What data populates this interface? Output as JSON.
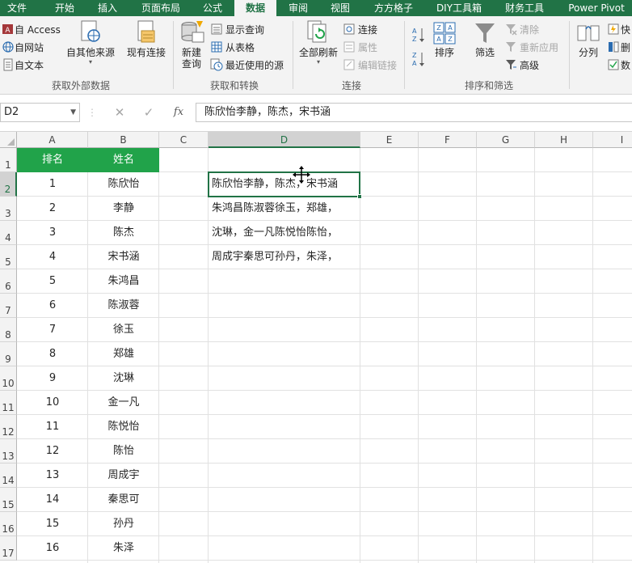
{
  "ribbon_tabs": [
    "文件",
    "开始",
    "插入",
    "页面布局",
    "公式",
    "数据",
    "审阅",
    "视图",
    "方方格子",
    "DIY工具箱",
    "财务工具",
    "Power Pivot"
  ],
  "active_tab": "数据",
  "get_external": {
    "access": "自 Access",
    "web": "自网站",
    "text": "自文本",
    "other_sources": "自其他来源",
    "existing": "现有连接",
    "group_label": "获取外部数据"
  },
  "get_transform": {
    "new_query_l1": "新建",
    "new_query_l2": "查询",
    "show_queries": "显示查询",
    "from_table": "从表格",
    "recent_sources": "最近使用的源",
    "group_label": "获取和转换"
  },
  "connections": {
    "refresh_all": "全部刷新",
    "connections": "连接",
    "properties": "属性",
    "edit_links": "编辑链接",
    "group_label": "连接"
  },
  "sort_filter": {
    "sort": "排序",
    "filter": "筛选",
    "clear": "清除",
    "reapply": "重新应用",
    "advanced": "高级",
    "group_label": "排序和筛选"
  },
  "data_tools": {
    "text_to_columns": "分列",
    "flash_fill": "快",
    "remove_dup": "删",
    "validation": "数"
  },
  "formula_bar": {
    "name_box": "D2",
    "cancel": "✕",
    "enter": "✓",
    "fx": "fx",
    "content": "陈欣怡李静，陈杰，宋书涵"
  },
  "columns": [
    "A",
    "B",
    "C",
    "D",
    "E",
    "F",
    "G",
    "H",
    "I"
  ],
  "rows": [
    "1",
    "2",
    "3",
    "4",
    "5",
    "6",
    "7",
    "8",
    "9",
    "10",
    "11",
    "12",
    "13",
    "14",
    "15",
    "16",
    "17"
  ],
  "header_row": {
    "rank": "排名",
    "name": "姓名"
  },
  "table": [
    {
      "rank": "1",
      "name": "陈欣怡"
    },
    {
      "rank": "2",
      "name": "李静"
    },
    {
      "rank": "3",
      "name": "陈杰"
    },
    {
      "rank": "4",
      "name": "宋书涵"
    },
    {
      "rank": "5",
      "name": "朱鸿昌"
    },
    {
      "rank": "6",
      "name": "陈淑蓉"
    },
    {
      "rank": "7",
      "name": "徐玉"
    },
    {
      "rank": "8",
      "name": "郑雄"
    },
    {
      "rank": "9",
      "name": "沈琳"
    },
    {
      "rank": "10",
      "name": "金一凡"
    },
    {
      "rank": "11",
      "name": "陈悦怡"
    },
    {
      "rank": "12",
      "name": "陈怡"
    },
    {
      "rank": "13",
      "name": "周成宇"
    },
    {
      "rank": "14",
      "name": "秦思可"
    },
    {
      "rank": "15",
      "name": "孙丹"
    },
    {
      "rank": "16",
      "name": "朱泽"
    }
  ],
  "d_column": [
    "陈欣怡李静，陈杰，宋书涵",
    "朱鸿昌陈淑蓉徐玉，郑雄，",
    "沈琳，金一凡陈悦怡陈怡，",
    "周成宇秦思可孙丹，朱泽，"
  ],
  "colors": {
    "brand": "#217346",
    "header_fill": "#21a34a"
  }
}
